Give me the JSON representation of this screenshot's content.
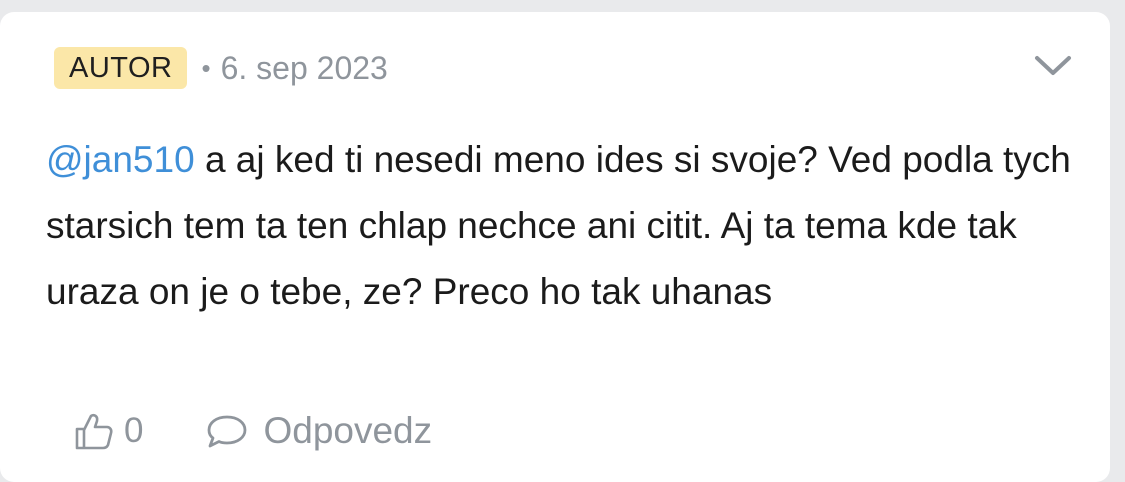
{
  "comment": {
    "badge": "AUTOR",
    "separator": "•",
    "date": "6. sep 2023",
    "mention": "@jan510",
    "text": " a aj ked ti nesedi meno ides si svoje? Ved podla tych starsich tem ta ten chlap nechce ani citit. Aj ta tema kde tak uraza on je o tebe, ze? Preco ho tak uhanas",
    "like_count": "0",
    "reply_label": "Odpovedz"
  },
  "icons": {
    "expand": "chevron-down-icon",
    "like": "thumbs-up-icon",
    "reply": "speech-bubble-icon"
  },
  "colors": {
    "badge_bg": "#fbe7a8",
    "mention": "#3f8fd8",
    "muted": "#8f959c",
    "page_bg": "#e9eaec"
  }
}
